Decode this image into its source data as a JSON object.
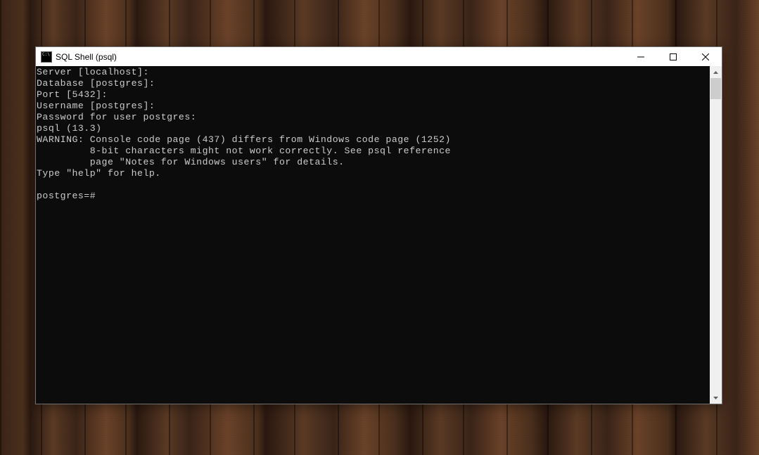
{
  "window": {
    "title": "SQL Shell (psql)"
  },
  "terminal": {
    "lines": [
      "Server [localhost]:",
      "Database [postgres]:",
      "Port [5432]:",
      "Username [postgres]:",
      "Password for user postgres:",
      "psql (13.3)",
      "WARNING: Console code page (437) differs from Windows code page (1252)",
      "         8-bit characters might not work correctly. See psql reference",
      "         page \"Notes for Windows users\" for details.",
      "Type \"help\" for help.",
      "",
      "postgres=#"
    ]
  }
}
